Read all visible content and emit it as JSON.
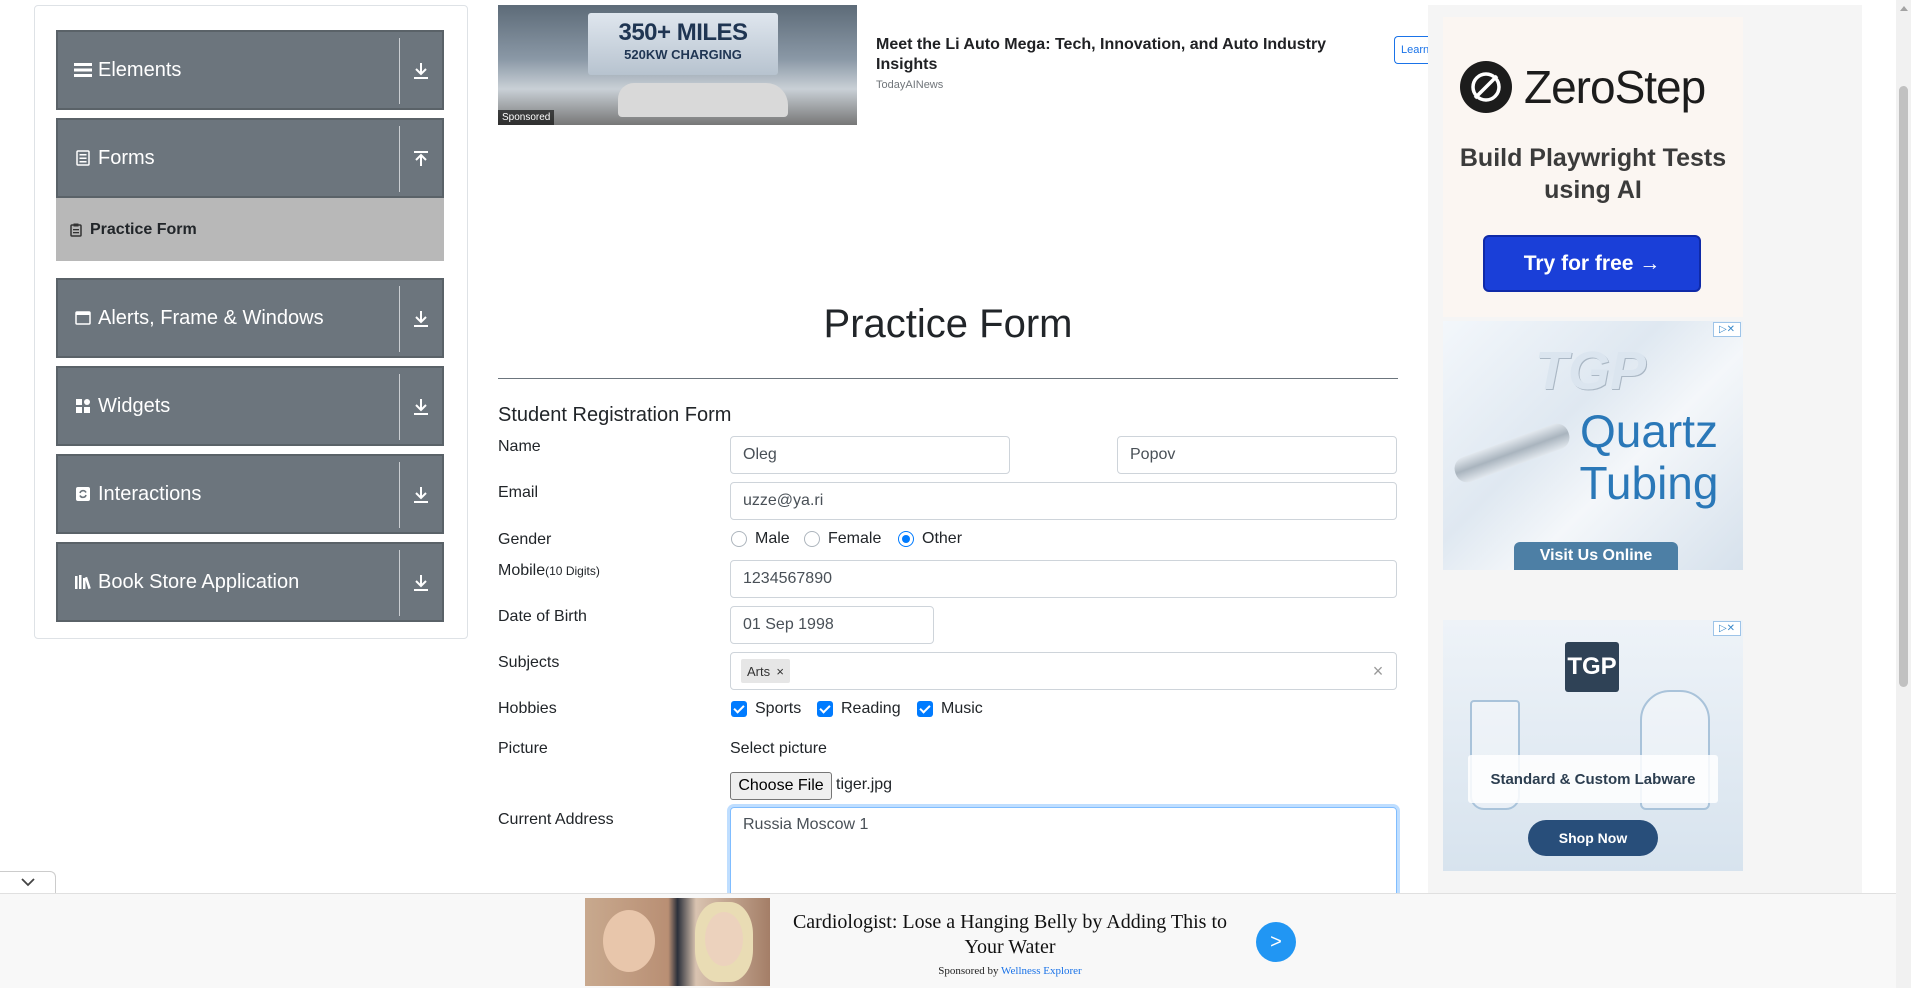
{
  "sidebar": {
    "groups": [
      {
        "label": "Elements",
        "icon": "list-icon",
        "arrow": "download-icon"
      },
      {
        "label": "Forms",
        "icon": "document-icon",
        "arrow": "upload-icon"
      },
      {
        "label": "Alerts, Frame & Windows",
        "icon": "window-icon",
        "arrow": "download-icon"
      },
      {
        "label": "Widgets",
        "icon": "grid-icon",
        "arrow": "download-icon"
      },
      {
        "label": "Interactions",
        "icon": "refresh-icon",
        "arrow": "download-icon"
      },
      {
        "label": "Book Store Application",
        "icon": "books-icon",
        "arrow": "download-icon"
      }
    ],
    "active_item": {
      "label": "Practice Form",
      "icon": "clipboard-icon"
    }
  },
  "top_ad": {
    "billboard_line1": "350+ MILES",
    "billboard_line2": "520KW CHARGING",
    "sponsored_label": "Sponsored",
    "title": "Meet the Li Auto Mega: Tech, Innovation, and Auto Industry Insights",
    "source": "TodayAINews",
    "button": "Learn"
  },
  "page": {
    "title": "Practice Form",
    "form_title": "Student Registration Form"
  },
  "form": {
    "name_label": "Name",
    "first_name": "Oleg",
    "last_name": "Popov",
    "email_label": "Email",
    "email": "uzze@ya.ri",
    "gender_label": "Gender",
    "gender_options": [
      "Male",
      "Female",
      "Other"
    ],
    "gender_selected": "Other",
    "mobile_label": "Mobile",
    "mobile_hint": "(10 Digits)",
    "mobile": "1234567890",
    "dob_label": "Date of Birth",
    "dob": "01 Sep 1998",
    "subjects_label": "Subjects",
    "subjects": [
      "Arts"
    ],
    "subject_remove": "×",
    "subjects_clear": "×",
    "hobbies_label": "Hobbies",
    "hobbies": [
      "Sports",
      "Reading",
      "Music"
    ],
    "picture_label": "Picture",
    "select_picture": "Select picture",
    "choose_file": "Choose File",
    "file_name": "tiger.jpg",
    "address_label": "Current Address",
    "address": "Russia Moscow 1"
  },
  "right_ads": {
    "zerostep": {
      "name": "ZeroStep",
      "tagline": "Build Playwright Tests using AI",
      "button": "Try for free →"
    },
    "tgp_quartz": {
      "brand": "TGP",
      "headline": "Quartz Tubing",
      "button": "Visit Us Online"
    },
    "tgp_labware": {
      "brand": "TGP",
      "label": "Standard & Custom Labware",
      "button": "Shop Now"
    },
    "adchoice": "▷✕"
  },
  "bottom_ad": {
    "title": "Cardiologist: Lose a Hanging Belly by Adding This to Your Water",
    "sponsored_prefix": "Sponsored by",
    "sponsor": "Wellness Explorer",
    "go": ">"
  },
  "colors": {
    "sidebar_group_bg": "#6c757d",
    "active_item_bg": "#b8b8b8",
    "accent": "#007bff",
    "zerostep_button": "#1a3fd8"
  }
}
